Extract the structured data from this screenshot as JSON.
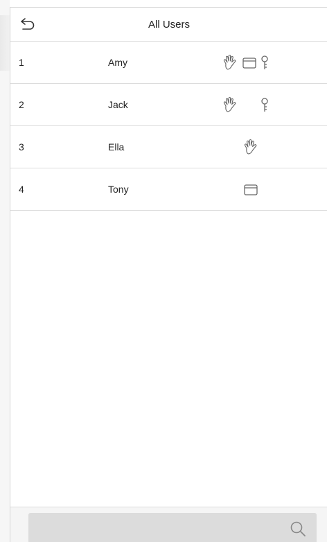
{
  "header": {
    "title": "All Users",
    "back_icon": "back-arrow-icon"
  },
  "users": [
    {
      "number": "1",
      "name": "Amy",
      "methods": [
        "fingerprint",
        "card",
        "password"
      ]
    },
    {
      "number": "2",
      "name": "Jack",
      "methods": [
        "fingerprint",
        "password"
      ]
    },
    {
      "number": "3",
      "name": "Ella",
      "methods": [
        "fingerprint"
      ]
    },
    {
      "number": "4",
      "name": "Tony",
      "methods": [
        "card"
      ]
    }
  ],
  "icons": {
    "fingerprint": "palm-icon",
    "card": "card-icon",
    "password": "key-icon",
    "search": "search-icon"
  },
  "colors": {
    "background": "#ffffff",
    "divider": "#dcdcdc",
    "search_bar": "#dcdcdc",
    "icon_stroke": "#666666",
    "text": "#222222"
  }
}
